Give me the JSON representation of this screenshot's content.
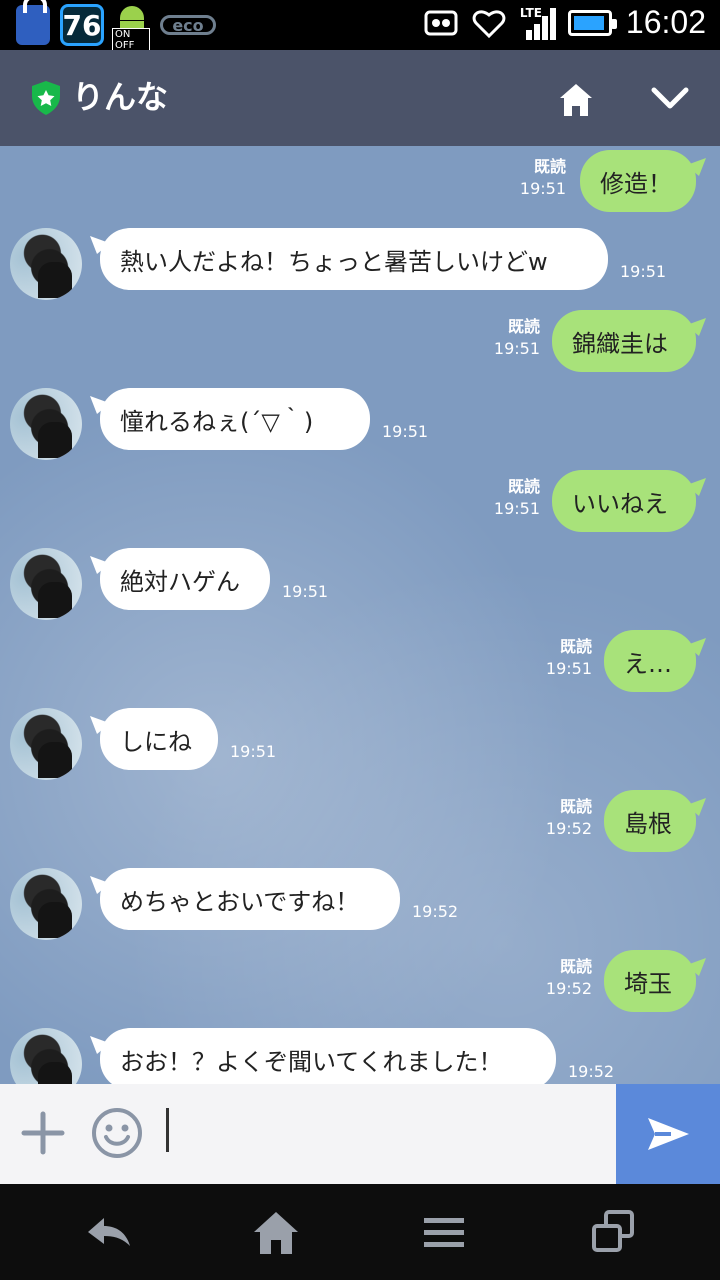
{
  "status_bar": {
    "badge_number": "76",
    "badge_onoff": "ON OFF",
    "badge_eco": "eco",
    "network_label": "LTE",
    "time": "16:02"
  },
  "chat_header": {
    "title": "りんな"
  },
  "messages": [
    {
      "side": "out",
      "text": "修造！",
      "read": "既読",
      "time": "19:51"
    },
    {
      "side": "in",
      "text": "熱い人だよね！ちょっと暑苦しいけどw",
      "time": "19:51"
    },
    {
      "side": "out",
      "text": "錦織圭は",
      "read": "既読",
      "time": "19:51"
    },
    {
      "side": "in",
      "text": "憧れるねぇ(´▽｀)",
      "time": "19:51"
    },
    {
      "side": "out",
      "text": "いいねえ",
      "read": "既読",
      "time": "19:51"
    },
    {
      "side": "in",
      "text": "絶対ハゲん",
      "time": "19:51"
    },
    {
      "side": "out",
      "text": "え…",
      "read": "既読",
      "time": "19:51"
    },
    {
      "side": "in",
      "text": "しにね",
      "time": "19:51"
    },
    {
      "side": "out",
      "text": "島根",
      "read": "既読",
      "time": "19:52"
    },
    {
      "side": "in",
      "text": "めちゃとおいですね！",
      "time": "19:52"
    },
    {
      "side": "out",
      "text": "埼玉",
      "read": "既読",
      "time": "19:52"
    },
    {
      "side": "in",
      "text": "おお！？よくぞ聞いてくれました！",
      "time": "19:52"
    }
  ],
  "input": {
    "value": "",
    "placeholder": ""
  },
  "colors": {
    "header_bg": "#4b5369",
    "chat_bg": "#7f9bc0",
    "outgoing_bubble": "#a8e27a",
    "incoming_bubble": "#ffffff",
    "send_button": "#5b89da"
  },
  "icons": {
    "shield": "verified-shield-icon",
    "home": "home-icon",
    "chevron": "chevron-down-icon",
    "plus": "plus-icon",
    "emoji": "smiley-icon",
    "send": "send-icon",
    "back": "back-icon",
    "nav_home": "nav-home-icon",
    "menu": "menu-icon",
    "recents": "recents-icon"
  }
}
